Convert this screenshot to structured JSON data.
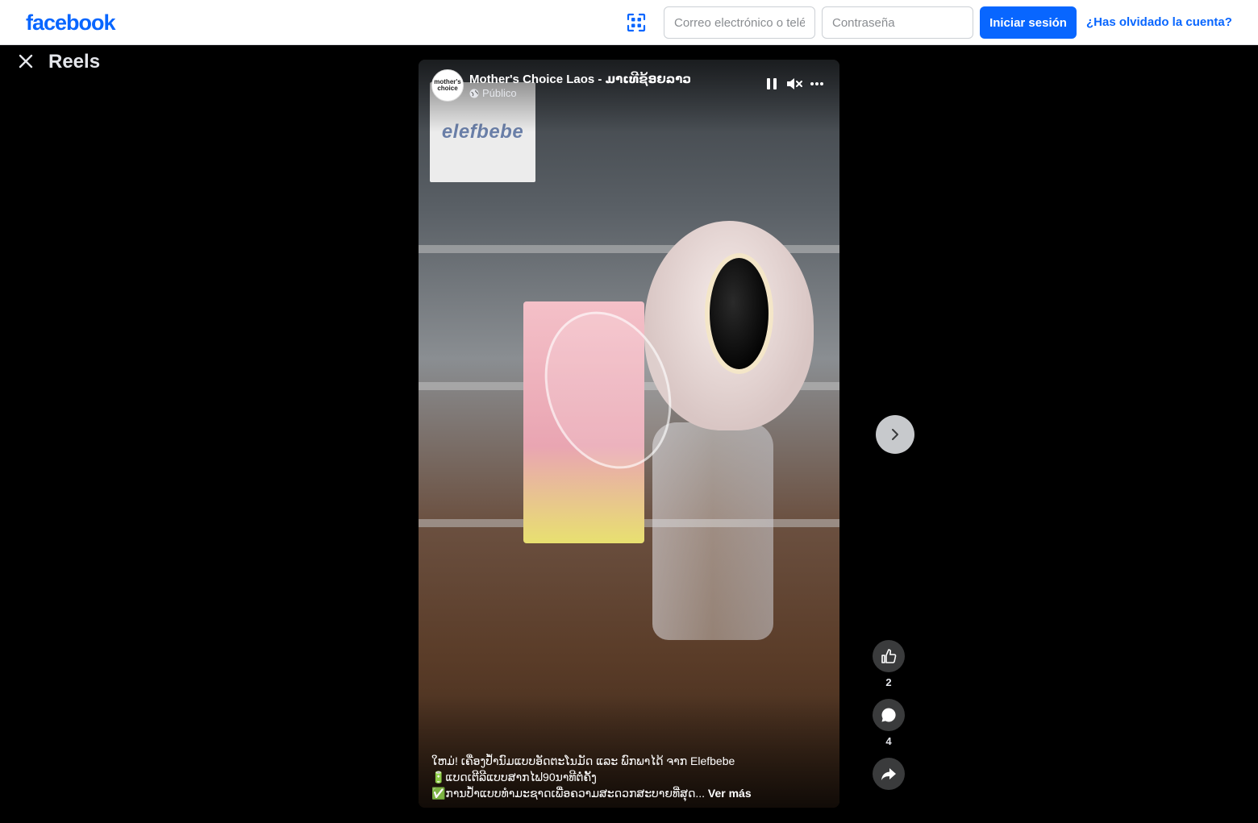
{
  "header": {
    "logo": "facebook",
    "email_placeholder": "Correo electrónico o teléfono",
    "password_placeholder": "Contraseña",
    "login_label": "Iniciar sesión",
    "forgot_label": "¿Has olvidado la cuenta?"
  },
  "page": {
    "title": "Reels"
  },
  "reel": {
    "author": "Mother's Choice Laos - ມາເທີຊ້ອຍລາວ",
    "avatar_text_line1": "mother's",
    "avatar_text_line2": "choice",
    "visibility": "Público",
    "brand_overlay": "elefbebe",
    "caption_lines": [
      "ໃຫມ່! ເຄື່ອງປໍ້ານົມແບບອັດຕະໂນມັດ ແລະ ພົກພາໄດ້ ຈາກ Elefbebe",
      "🔋ແບດເຕີລີແບບສາກໄຟ90ນາທີຕໍ່ຄັ້ງ",
      "✅ການປໍ້າແບບທໍາມະຊາດເພື່ອຄວາມສະດວກສະບາຍທີ່ສຸດ..."
    ],
    "see_more": "Ver más"
  },
  "actions": {
    "like_count": "2",
    "comment_count": "4"
  },
  "icons": {
    "qr": "qr-scan-icon",
    "close": "close-icon",
    "pause": "pause-icon",
    "mute": "muted-speaker-icon",
    "more": "more-icon",
    "globe": "globe-icon",
    "next": "chevron-right-icon",
    "like": "thumbs-up-icon",
    "comment": "comment-icon",
    "share": "share-icon"
  },
  "colors": {
    "brand": "#0866ff",
    "background": "#000000",
    "action_bg": "#3a3b3c"
  }
}
